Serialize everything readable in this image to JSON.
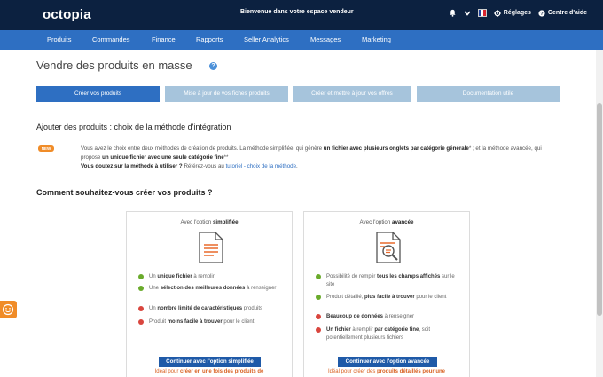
{
  "header": {
    "logo": "octopia",
    "welcome": "Bienvenue dans votre espace vendeur",
    "settings_label": "Réglages",
    "help_label": "Centre d'aide",
    "colors": {
      "topbar": "#0c2140",
      "nav": "#2e6fc2"
    }
  },
  "nav": {
    "items": [
      "Produits",
      "Commandes",
      "Finance",
      "Rapports",
      "Seller Analytics",
      "Messages",
      "Marketing"
    ]
  },
  "page": {
    "title": "Vendre des produits en masse",
    "tabs": [
      "Créer vos produits",
      "Mise à jour de vos fiches produits",
      "Créer et mettre à jour vos offres",
      "Documentation utile"
    ],
    "section1_title": "Ajouter des produits : choix de la méthode d'intégration",
    "new_badge": "NEW",
    "intro": {
      "p1a": "Vous avez le choix entre deux méthodes de création de produits. La méthode simplifiée, qui génère ",
      "p1b": "un fichier avec plusieurs onglets par catégorie générale",
      "p1c": "* ; et la méthode avancée, qui propose ",
      "p1d": "un unique fichier avec une seule catégorie fine",
      "p1e": "**",
      "p2a": "Vous doutez sur la méthode à utiliser ?",
      "p2b": " Référez-vous au ",
      "p2link": "tutoriel - choix de la méthode",
      "p2c": "."
    },
    "section2_title": "Comment souhaitez-vous créer vos produits ?"
  },
  "cards": {
    "simple": {
      "title_pre": "Avec l'option ",
      "title_bold": "simplifiée",
      "features": [
        {
          "pre": "Un ",
          "bold": "unique fichier",
          "post": " à remplir",
          "status": "good"
        },
        {
          "pre": "Une ",
          "bold": "sélection des meilleures données",
          "post": " à renseigner",
          "status": "good"
        },
        {
          "pre": "Un ",
          "bold": "nombre limité de caractéristiques",
          "post": " produits",
          "status": "bad"
        },
        {
          "pre": "Produit ",
          "bold": "moins facile à trouver",
          "post": " pour le client",
          "status": "bad"
        }
      ],
      "cta": "Continuer avec l'option simplifiée",
      "note_pre": "Idéal pour ",
      "note_bold": "créer en une fois des produits de"
    },
    "advanced": {
      "title_pre": "Avec l'option ",
      "title_bold": "avancée",
      "features": [
        {
          "pre": "Possibilité de remplir ",
          "bold": "tous les champs affichés",
          "post": " sur le site",
          "status": "good"
        },
        {
          "pre": "Produit détaillé, ",
          "bold": "plus facile à trouver",
          "post": " pour le client",
          "status": "good"
        },
        {
          "pre": "",
          "bold": "Beaucoup de données",
          "post": " à renseigner",
          "status": "bad"
        },
        {
          "pre": "",
          "bold": "Un fichier",
          "post": " à remplir ",
          "bold2": "par catégorie fine",
          "post2": ", soit potentiellement plusieurs fichiers",
          "status": "bad"
        }
      ],
      "cta": "Continuer avec l'option avancée",
      "note_pre": "Idéal pour créer des ",
      "note_bold": "produits détaillés pour une"
    }
  }
}
